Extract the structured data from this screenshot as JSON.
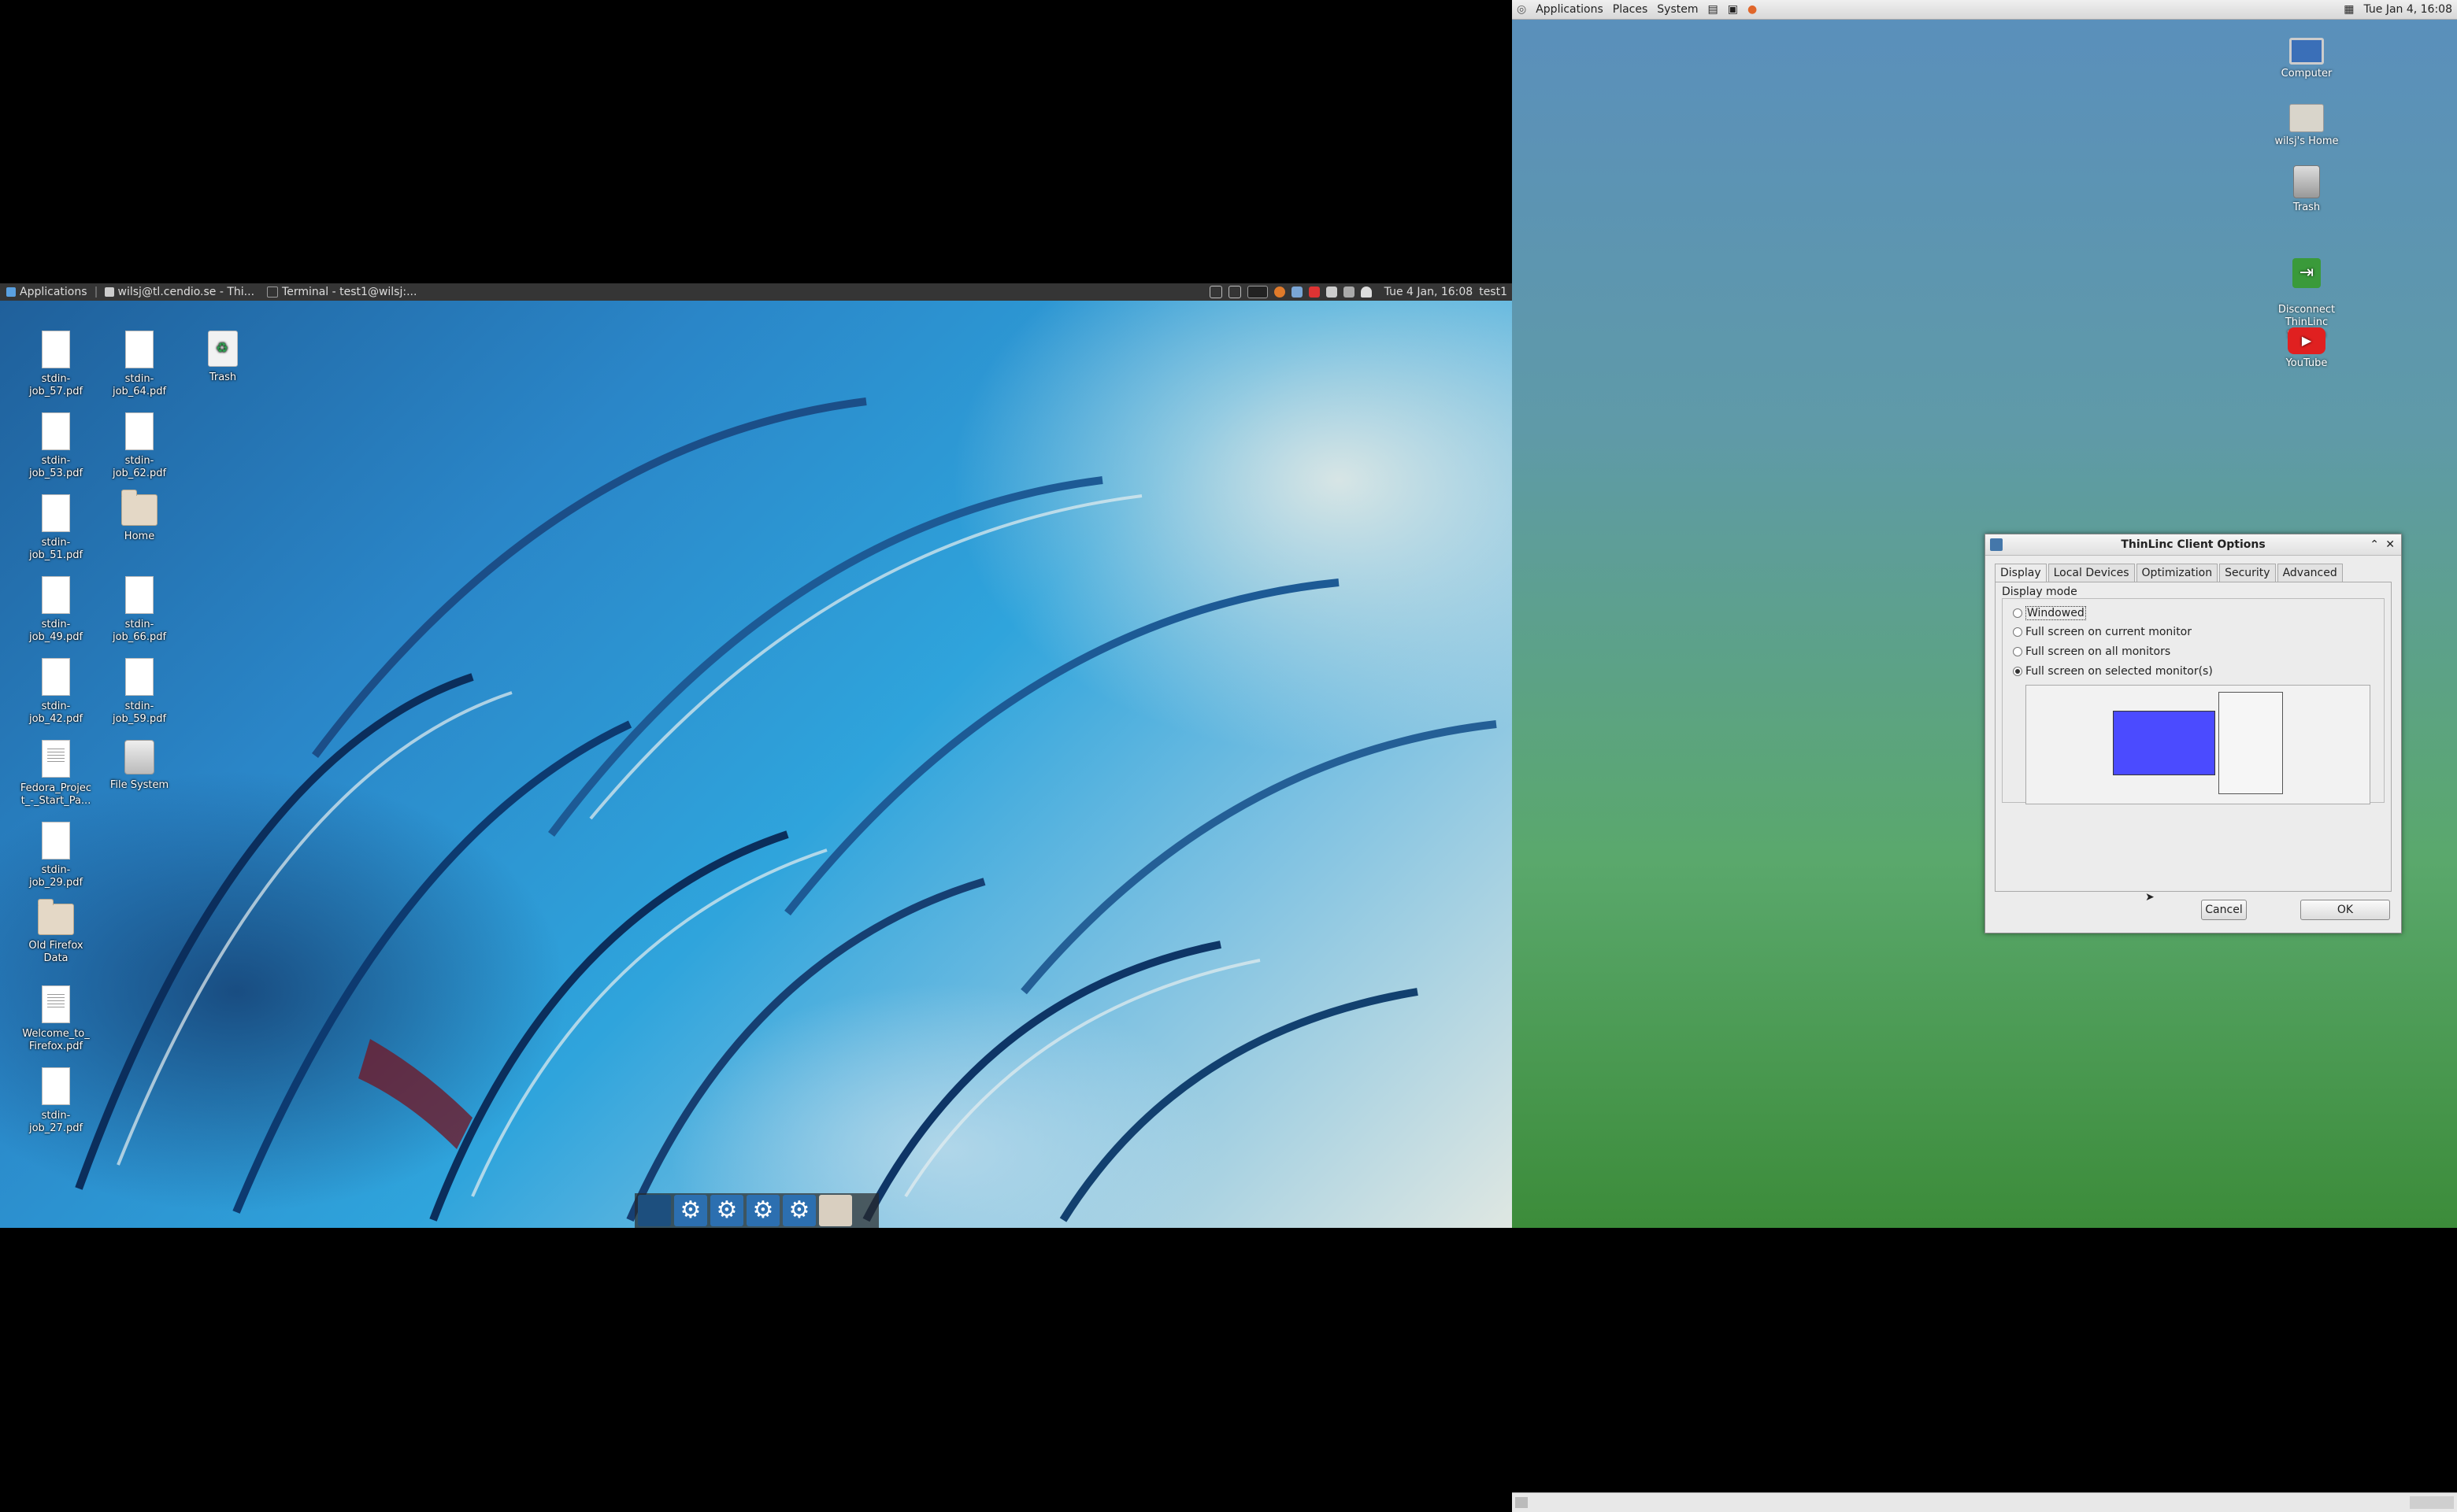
{
  "remote": {
    "panel": {
      "applications": "Applications",
      "task1": "wilsj@tl.cendio.se - Thi...",
      "task2": "Terminal - test1@wilsj:...",
      "clock": "Tue  4 Jan, 16:08",
      "user": "test1"
    },
    "icons": [
      {
        "name": "stdin-\njob_57.pdf",
        "type": "doc"
      },
      {
        "name": "stdin-\njob_64.pdf",
        "type": "doc"
      },
      {
        "name": "Trash",
        "type": "trash"
      },
      {
        "name": "stdin-\njob_53.pdf",
        "type": "doc"
      },
      {
        "name": "stdin-\njob_62.pdf",
        "type": "doc"
      },
      {
        "name": "stdin-\njob_51.pdf",
        "type": "doc"
      },
      {
        "name": "Home",
        "type": "folder"
      },
      {
        "name": "stdin-\njob_49.pdf",
        "type": "doc"
      },
      {
        "name": "stdin-\njob_66.pdf",
        "type": "doc"
      },
      {
        "name": "stdin-\njob_42.pdf",
        "type": "doc"
      },
      {
        "name": "stdin-\njob_59.pdf",
        "type": "doc"
      },
      {
        "name": "Fedora_Projec\nt_-_Start_Pa...",
        "type": "textdoc"
      },
      {
        "name": "File System",
        "type": "disk"
      },
      {
        "name": "stdin-\njob_29.pdf",
        "type": "doc"
      },
      {
        "name": "Old Firefox\nData",
        "type": "folder"
      },
      {
        "name": "Welcome_to_\nFirefox.pdf",
        "type": "textdoc"
      },
      {
        "name": "stdin-\njob_27.pdf",
        "type": "doc"
      }
    ]
  },
  "local": {
    "panel": {
      "applications": "Applications",
      "places": "Places",
      "system": "System",
      "clock": "Tue Jan  4, 16:08"
    },
    "icons": {
      "computer": "Computer",
      "home": "wilsj's Home",
      "trash": "Trash",
      "disconnect": "Disconnect ThinLinc\nSession",
      "youtube": "YouTube"
    }
  },
  "dialog": {
    "title": "ThinLinc Client Options",
    "tabs": [
      "Display",
      "Local Devices",
      "Optimization",
      "Security",
      "Advanced"
    ],
    "active_tab": "Display",
    "group_label": "Display mode",
    "options": [
      "Windowed",
      "Full screen on current monitor",
      "Full screen on all monitors",
      "Full screen on selected monitor(s)"
    ],
    "selected_option": "Full screen on selected monitor(s)",
    "cancel": "Cancel",
    "ok": "OK"
  }
}
